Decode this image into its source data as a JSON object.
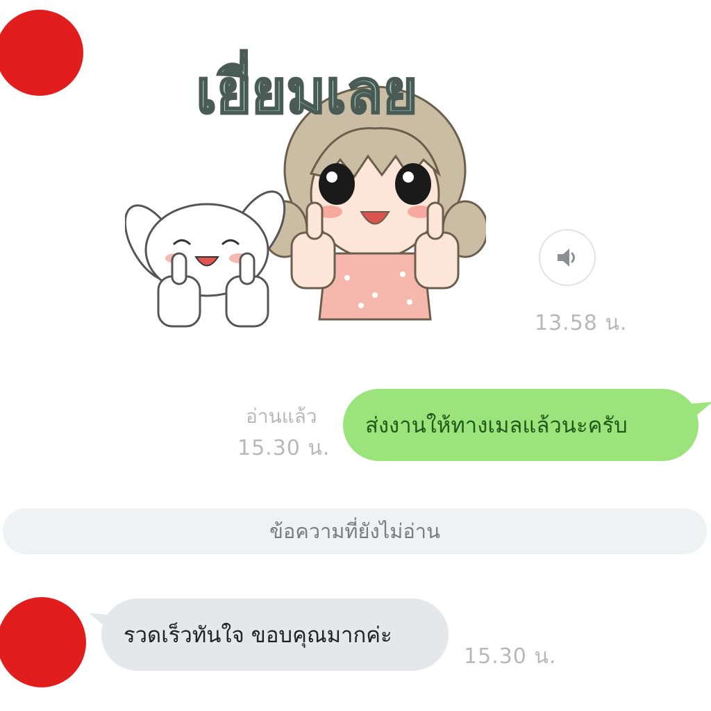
{
  "colors": {
    "avatar": "#e11d1d",
    "outgoing_bubble": "#9be37b",
    "outgoing_text": "#1d5a1a",
    "incoming_bubble": "#e5e7ea",
    "divider_bg": "#f0f1f3",
    "sticker_text": "#a8dcc8"
  },
  "sticker_message": {
    "sticker_text": "เยี่ยมเลย",
    "sound_icon": "speaker-icon",
    "time": "13.58 น."
  },
  "outgoing_message": {
    "text": "ส่งงานให้ทางเมลแล้วนะครับ",
    "read_status": "อ่านแล้ว",
    "time": "15.30 น."
  },
  "unread_divider": {
    "label": "ข้อความที่ยังไม่อ่าน"
  },
  "incoming_message": {
    "text": "รวดเร็วทันใจ ขอบคุณมากค่ะ",
    "time": "15.30 น."
  }
}
